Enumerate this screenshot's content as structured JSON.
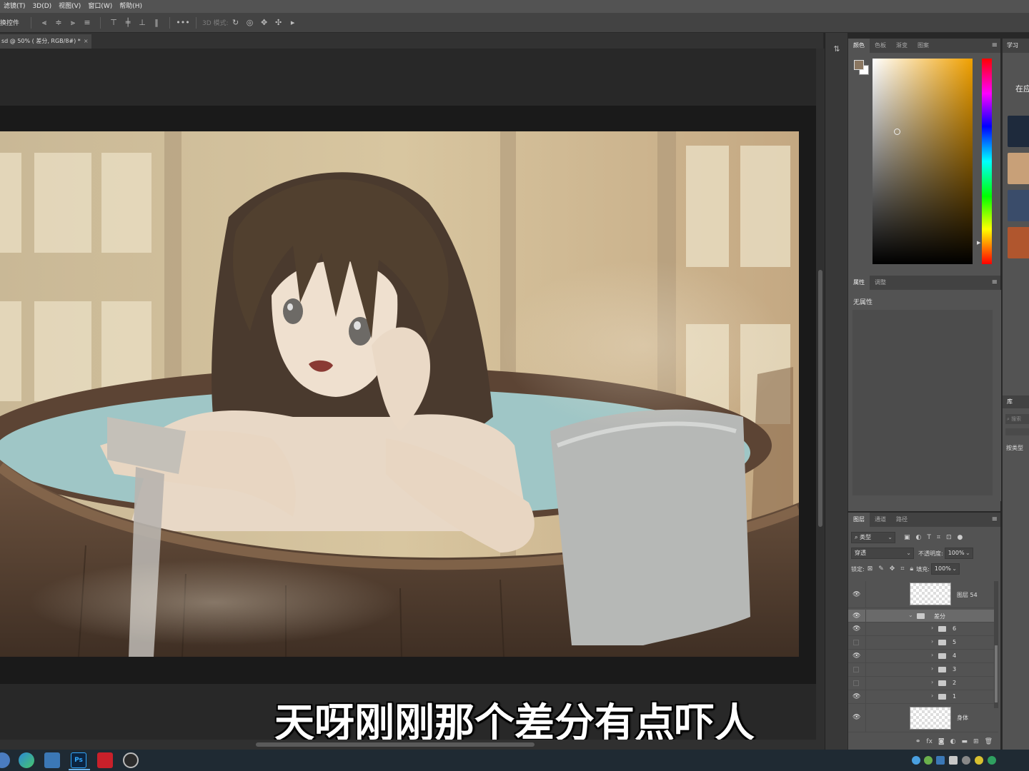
{
  "menubar": {
    "items": [
      "滤镜(T)",
      "3D(D)",
      "视图(V)",
      "窗口(W)",
      "帮助(H)"
    ]
  },
  "options": {
    "label": "换控件",
    "more": "•••",
    "mode3d_label": "3D 模式:"
  },
  "document": {
    "tab_title": "sd @ 50% ( 差分, RGB/8#) *",
    "close": "×"
  },
  "canvas": {
    "subtitle": "天呀刚刚那个差分有点吓人"
  },
  "color_panel": {
    "tabs": [
      "颜色",
      "色板",
      "渐变",
      "图案"
    ],
    "foreground": "#8b7761",
    "background": "#ffffff",
    "menu": "≡"
  },
  "properties_panel": {
    "tabs": [
      "属性",
      "调整"
    ],
    "empty_text": "无属性",
    "menu": "≡"
  },
  "layers_panel": {
    "tabs": [
      "图层",
      "通道",
      "路径"
    ],
    "menu": "≡",
    "filter_kind": "类型",
    "blend_mode": "穿透",
    "opacity_label": "不透明度:",
    "opacity_value": "100%",
    "lock_label": "锁定:",
    "fill_label": "填充:",
    "fill_value": "100%",
    "layers": [
      {
        "name": "图层 54",
        "kind": "pixel",
        "visible": true
      },
      {
        "name": "差分",
        "kind": "group-open",
        "visible": true
      },
      {
        "name": "6",
        "kind": "group",
        "visible": true
      },
      {
        "name": "5",
        "kind": "group",
        "visible": false
      },
      {
        "name": "4",
        "kind": "group",
        "visible": true
      },
      {
        "name": "3",
        "kind": "group",
        "visible": false
      },
      {
        "name": "2",
        "kind": "group",
        "visible": false
      },
      {
        "name": "1",
        "kind": "group",
        "visible": true
      },
      {
        "name": "身体",
        "kind": "pixel",
        "visible": true
      }
    ],
    "footer_icons": [
      "link-icon",
      "fx-icon",
      "mask-icon",
      "adjustment-icon",
      "folder-icon",
      "new-layer-icon",
      "trash-icon"
    ]
  },
  "learn_panel": {
    "tab": "学习",
    "heading": "在应"
  },
  "library_panel": {
    "tab": "库",
    "search_placeholder": "搜索",
    "text": "按类型"
  },
  "taskbar": {
    "apps": [
      "edge-icon",
      "file-explorer-icon",
      "photoshop-icon",
      "wps-icon",
      "obs-icon"
    ],
    "photoshop_label": "Ps"
  }
}
